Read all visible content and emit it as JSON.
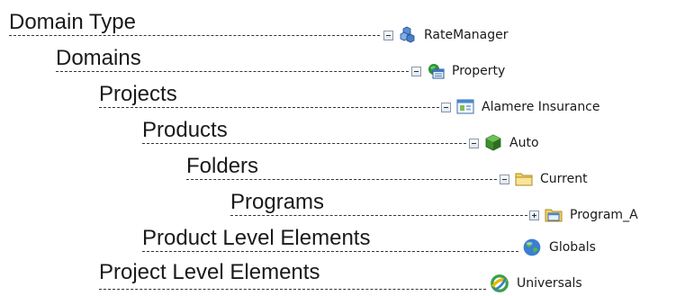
{
  "rows": [
    {
      "label": "Domain Type",
      "node": "RateManager",
      "toggle": "minus",
      "icon": "ratemanager-cubes-icon"
    },
    {
      "label": "Domains",
      "node": "Property",
      "toggle": "minus",
      "icon": "domain-window-icon"
    },
    {
      "label": "Projects",
      "node": "Alamere Insurance",
      "toggle": "minus",
      "icon": "project-window-icon"
    },
    {
      "label": "Products",
      "node": "Auto",
      "toggle": "minus",
      "icon": "product-cube-icon"
    },
    {
      "label": "Folders",
      "node": "Current",
      "toggle": "minus",
      "icon": "folder-icon"
    },
    {
      "label": "Programs",
      "node": "Program_A",
      "toggle": "plus",
      "icon": "program-folder-icon"
    },
    {
      "label": "Product Level Elements",
      "node": "Globals",
      "toggle": "none",
      "icon": "globe-icon"
    },
    {
      "label": "Project  Level Elements",
      "node": "Universals",
      "toggle": "none",
      "icon": "rings-icon"
    }
  ],
  "colors": {
    "label_text": "#1a1a1a",
    "leader_line": "#333333",
    "folder_yellow": "#f2d36b",
    "cube_green": "#3f8f2e",
    "globe_blue": "#3a7fd0"
  }
}
